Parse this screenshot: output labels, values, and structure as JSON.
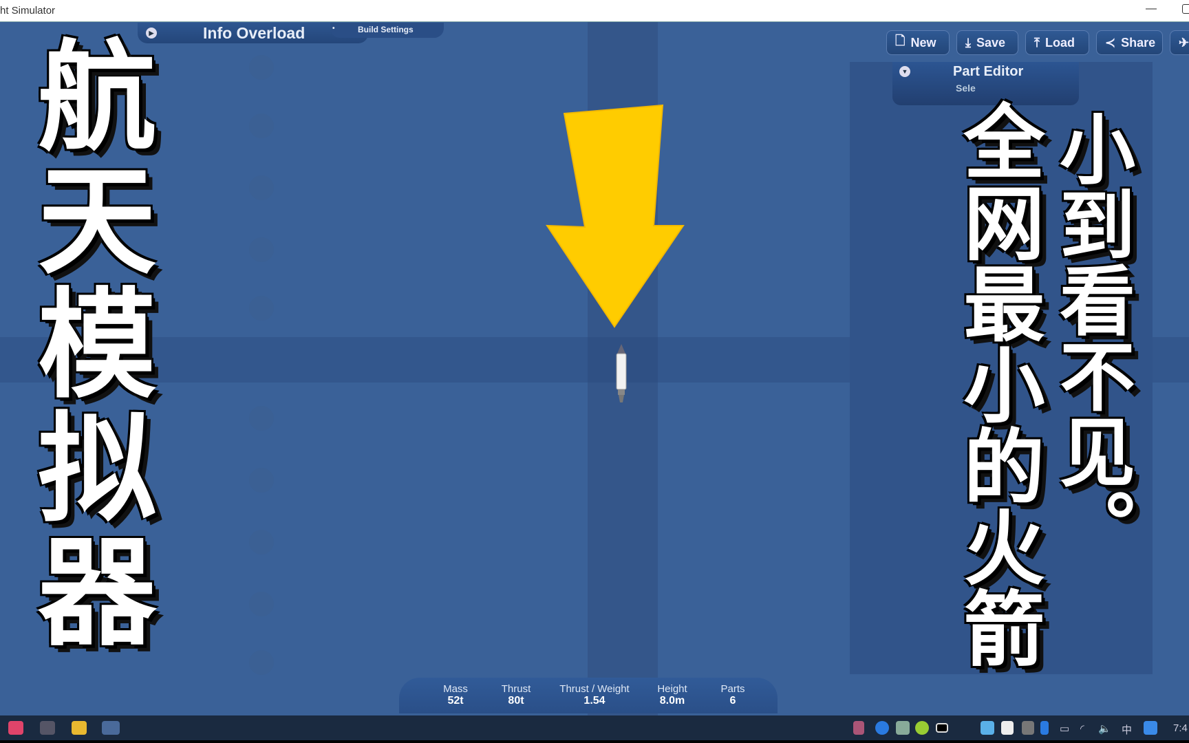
{
  "window": {
    "title": "ht Simulator"
  },
  "toolbar": {
    "info_label": "Info Overload",
    "build_label": "Build Settings",
    "buttons": [
      {
        "label": "New",
        "icon": "new-file-icon"
      },
      {
        "label": "Save",
        "icon": "download-icon"
      },
      {
        "label": "Load",
        "icon": "upload-icon"
      },
      {
        "label": "Share",
        "icon": "share-icon"
      }
    ]
  },
  "part_editor": {
    "title": "Part Editor",
    "subtitle": "Sele"
  },
  "stats": [
    {
      "label": "Mass",
      "value": "52t"
    },
    {
      "label": "Thrust",
      "value": "80t"
    },
    {
      "label": "Thrust / Weight",
      "value": "1.54"
    },
    {
      "label": "Height",
      "value": "8.0m"
    },
    {
      "label": "Parts",
      "value": "6"
    }
  ],
  "overlay": {
    "left_title": "航天模拟器",
    "right_col1": "全网最小的火箭",
    "right_col2": "小到看不见。"
  },
  "colors": {
    "background": "#3a6198",
    "arrow": "#ffcc00"
  },
  "taskbar": {
    "tray_ime": "中",
    "clock": "7:4"
  }
}
